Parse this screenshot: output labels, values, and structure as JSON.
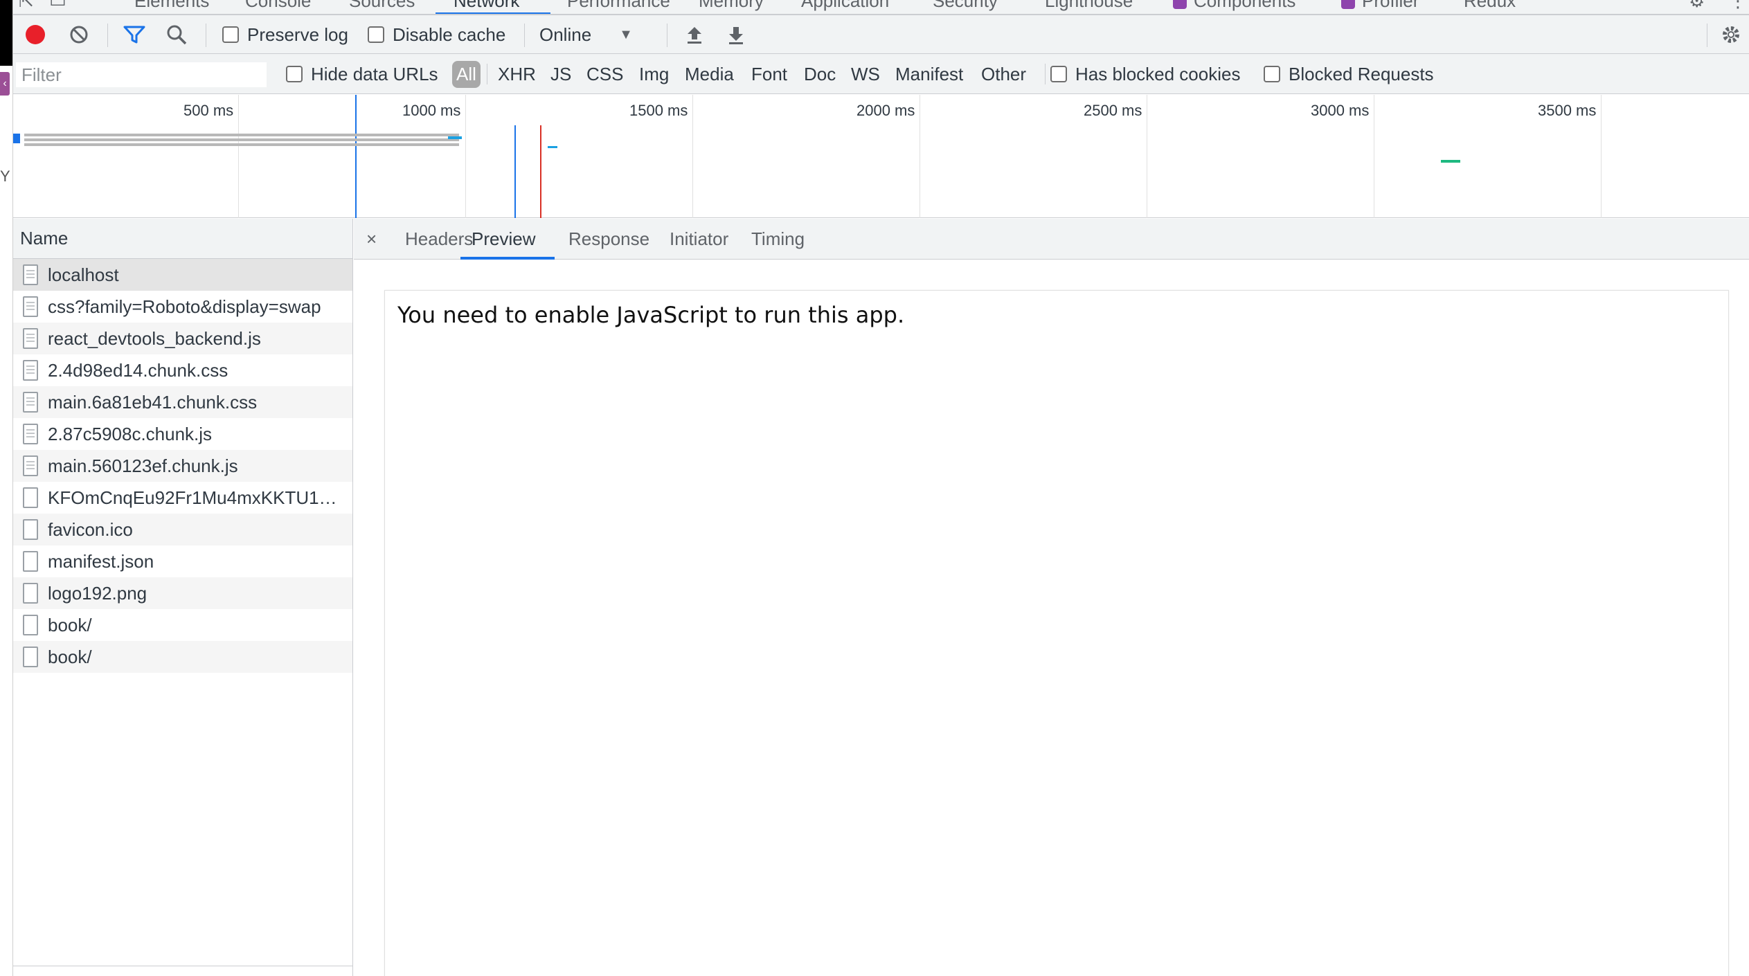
{
  "panel_tabs": [
    {
      "label": "Elements"
    },
    {
      "label": "Console"
    },
    {
      "label": "Sources"
    },
    {
      "label": "Network"
    },
    {
      "label": "Performance"
    },
    {
      "label": "Memory"
    },
    {
      "label": "Application"
    },
    {
      "label": "Security"
    },
    {
      "label": "Lighthouse"
    },
    {
      "label": "Components"
    },
    {
      "label": "Profiler"
    },
    {
      "label": "Redux"
    }
  ],
  "toolbar": {
    "preserve_log": "Preserve log",
    "disable_cache": "Disable cache",
    "throttle": "Online"
  },
  "filter": {
    "placeholder": "Filter",
    "hide_data_urls": "Hide data URLs",
    "types": [
      "All",
      "XHR",
      "JS",
      "CSS",
      "Img",
      "Media",
      "Font",
      "Doc",
      "WS",
      "Manifest",
      "Other"
    ],
    "has_blocked_cookies": "Has blocked cookies",
    "blocked_requests": "Blocked Requests"
  },
  "overview": {
    "ticks": [
      "500 ms",
      "1000 ms",
      "1500 ms",
      "2000 ms",
      "2500 ms",
      "3000 ms",
      "3500 ms"
    ],
    "dom_content_loaded_color": "#1a73e8",
    "load_color": "#d93025"
  },
  "request_list": {
    "header": "Name",
    "rows": [
      {
        "name": "localhost"
      },
      {
        "name": "css?family=Roboto&display=swap"
      },
      {
        "name": "react_devtools_backend.js"
      },
      {
        "name": "2.4d98ed14.chunk.css"
      },
      {
        "name": "main.6a81eb41.chunk.css"
      },
      {
        "name": "2.87c5908c.chunk.js"
      },
      {
        "name": "main.560123ef.chunk.js"
      },
      {
        "name": "KFOmCnqEu92Fr1Mu4mxKKTU1…"
      },
      {
        "name": "favicon.ico"
      },
      {
        "name": "manifest.json"
      },
      {
        "name": "logo192.png"
      },
      {
        "name": "book/"
      },
      {
        "name": "book/"
      }
    ]
  },
  "details": {
    "tabs": [
      "Headers",
      "Preview",
      "Response",
      "Initiator",
      "Timing"
    ],
    "close": "×",
    "preview_text": "You need to enable JavaScript to run this app."
  },
  "colors": {
    "accent": "#1a73e8",
    "record": "#e8202a"
  }
}
